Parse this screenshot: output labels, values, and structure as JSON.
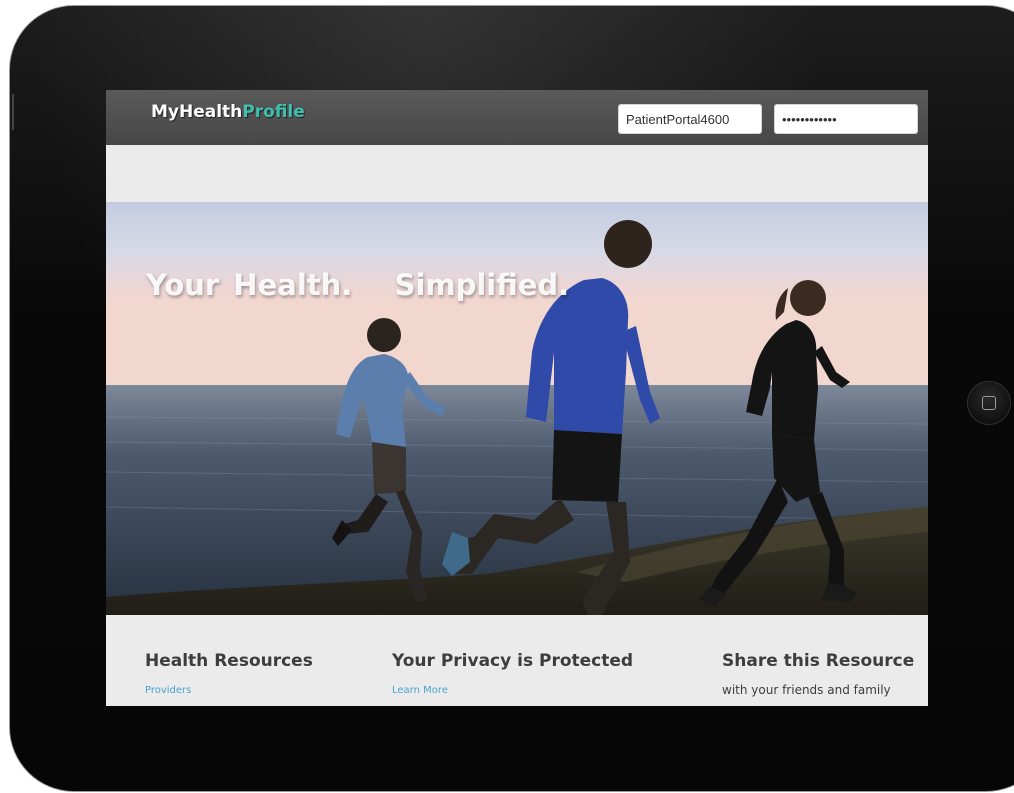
{
  "header": {
    "logo_main": "MyHealth",
    "logo_accent": "Profile",
    "username_value": "PatientPortal4600",
    "password_value": "••••••••••••"
  },
  "hero": {
    "headline": "Your Health.   Simplified."
  },
  "features": [
    {
      "title": "Health Resources",
      "link": "Providers"
    },
    {
      "title": "Your Privacy is Protected",
      "link": "Learn More"
    },
    {
      "title": "Share this Resource",
      "text": "with your friends and family"
    }
  ],
  "colors": {
    "brand_accent": "#3fbfae",
    "header_bar": "#4f4f4f",
    "link": "#4aa3d0",
    "page_bg": "#ebebeb"
  },
  "icons": {
    "home_button": "home-button-icon"
  }
}
